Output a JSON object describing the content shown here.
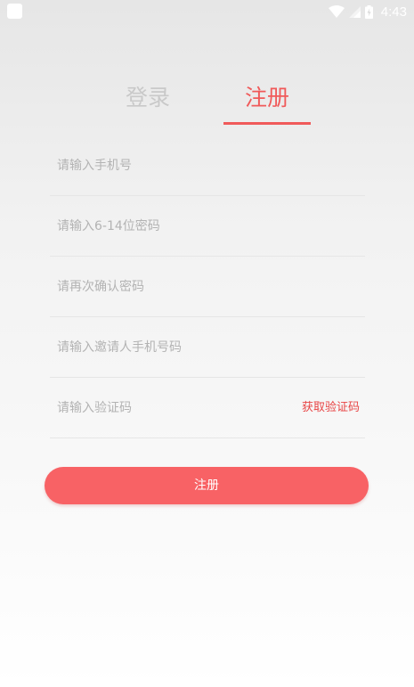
{
  "status_bar": {
    "time": "4:43",
    "icons": [
      "app-notification-icon",
      "wifi-icon",
      "signal-icon",
      "battery-icon"
    ]
  },
  "tabs": {
    "login_label": "登录",
    "register_label": "注册",
    "active": "register"
  },
  "form": {
    "phone_placeholder": "请输入手机号",
    "password_placeholder": "请输入6-14位密码",
    "confirm_password_placeholder": "请再次确认密码",
    "inviter_phone_placeholder": "请输入邀请人手机号码",
    "verification_code_placeholder": "请输入验证码",
    "get_code_label": "获取验证码",
    "submit_label": "注册"
  },
  "colors": {
    "accent": "#f05a5a",
    "button": "#f86265",
    "inactive_tab": "#c9c9c9",
    "placeholder": "#b3b3b3"
  }
}
